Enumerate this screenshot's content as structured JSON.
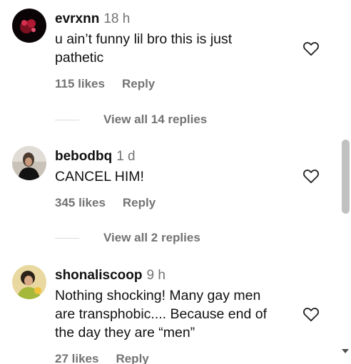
{
  "comments": [
    {
      "username": "evrxnn",
      "time": "18 h",
      "text": "u ain’t funny lil bro this is just pathetic",
      "likes": "115 likes",
      "reply": "Reply",
      "view_replies": "View all 14 replies"
    },
    {
      "username": "bebodbq",
      "time": "1 d",
      "text": "CANCEL HIM!",
      "likes": "345 likes",
      "reply": "Reply",
      "view_replies": "View all 2 replies"
    },
    {
      "username": "shonaliscoop",
      "time": "9 h",
      "text": "Nothing shocking! Many gay men are transphobic.... Because end of the day they are “men”",
      "likes": "27 likes",
      "reply": "Reply"
    }
  ],
  "icons": {
    "like": "heart-outline-icon",
    "scroll_down": "arrow-down-icon"
  },
  "colors": {
    "secondary_text": "#737373",
    "scrollbar_thumb": "#c1c1c1"
  }
}
